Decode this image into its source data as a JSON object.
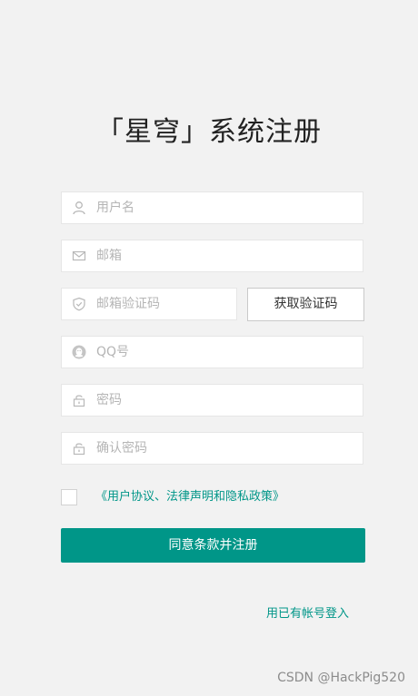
{
  "page": {
    "title": "「星穹」系统注册"
  },
  "form": {
    "username": {
      "placeholder": "用户名",
      "value": "",
      "icon": "user-icon"
    },
    "email": {
      "placeholder": "邮箱",
      "value": "",
      "icon": "mail-icon"
    },
    "email_code": {
      "placeholder": "邮箱验证码",
      "value": "",
      "icon": "shield-icon"
    },
    "get_code_label": "获取验证码",
    "qq": {
      "placeholder": "QQ号",
      "value": "",
      "icon": "qq-icon"
    },
    "password": {
      "placeholder": "密码",
      "value": "",
      "icon": "lock-icon"
    },
    "confirm_password": {
      "placeholder": "确认密码",
      "value": "",
      "icon": "lock-icon"
    },
    "agreement_checked": false,
    "agreement_text": "《用户协议、法律声明和隐私政策》",
    "submit_label": "同意条款并注册",
    "login_link": "用已有帐号登入"
  },
  "watermark": "CSDN @HackPig520",
  "colors": {
    "accent": "#009688",
    "background": "#f2f2f2",
    "placeholder": "#b5b5b5"
  }
}
